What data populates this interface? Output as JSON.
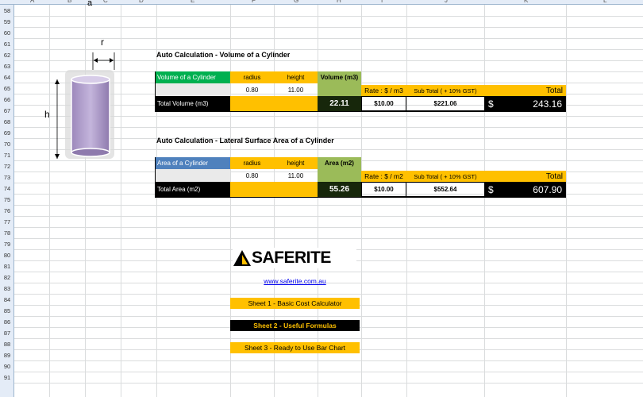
{
  "col_header_letters": [
    "A",
    "B",
    "C",
    "D",
    "E",
    "F",
    "G",
    "H",
    "I",
    "J",
    "K",
    "L"
  ],
  "row_numbers": [
    "58",
    "59",
    "60",
    "61",
    "62",
    "63",
    "64",
    "65",
    "66",
    "67",
    "68",
    "69",
    "70",
    "71",
    "72",
    "73",
    "74",
    "75",
    "76",
    "77",
    "78",
    "79",
    "80",
    "81",
    "82",
    "83",
    "84",
    "85",
    "86",
    "87",
    "88",
    "89",
    "90",
    "91"
  ],
  "diagram": {
    "top_label": "a",
    "r_label": "r",
    "h_label": "h"
  },
  "volume": {
    "title": "Auto Calculation - Volume of a Cylinder",
    "name_label": "Volume of a Cylinder",
    "radius_header": "radius",
    "height_header": "height",
    "result_header": "Volume (m3)",
    "radius": "0.80",
    "height": "11.00",
    "total_label": "Total Volume (m3)",
    "total_value": "22.11",
    "rate_label": "Rate : $ / m3",
    "subtotal_label": "Sub Total ( + 10% GST)",
    "total_header": "Total",
    "rate_value": "$10.00",
    "subtotal_value": "$221.06",
    "currency": "$",
    "grand_total": "243.16"
  },
  "area": {
    "title": "Auto Calculation - Lateral Surface Area of a Cylinder",
    "name_label": "Area of a Cylinder",
    "radius_header": "radius",
    "height_header": "height",
    "result_header": "Area (m2)",
    "radius": "0.80",
    "height": "11.00",
    "total_label": "Total Area (m2)",
    "total_value": "55.26",
    "rate_label": "Rate : $ / m2",
    "subtotal_label": "Sub Total ( + 10% GST)",
    "total_header": "Total",
    "rate_value": "$10.00",
    "subtotal_value": "$552.64",
    "currency": "$",
    "grand_total": "607.90"
  },
  "brand": {
    "logo_text_bold": "SAFE",
    "logo_text_rest": "RITE",
    "website": "www.saferite.com.au",
    "sheet1": "Sheet 1 - Basic Cost Calculator",
    "sheet2": "Sheet 2 - Useful Formulas",
    "sheet3": "Sheet 3 - Ready to Use Bar Chart"
  },
  "colors": {
    "orange": "#ffc000",
    "green": "#00b050",
    "olive": "#9bbb59",
    "black": "#000000",
    "dark_green": "#17270b"
  }
}
